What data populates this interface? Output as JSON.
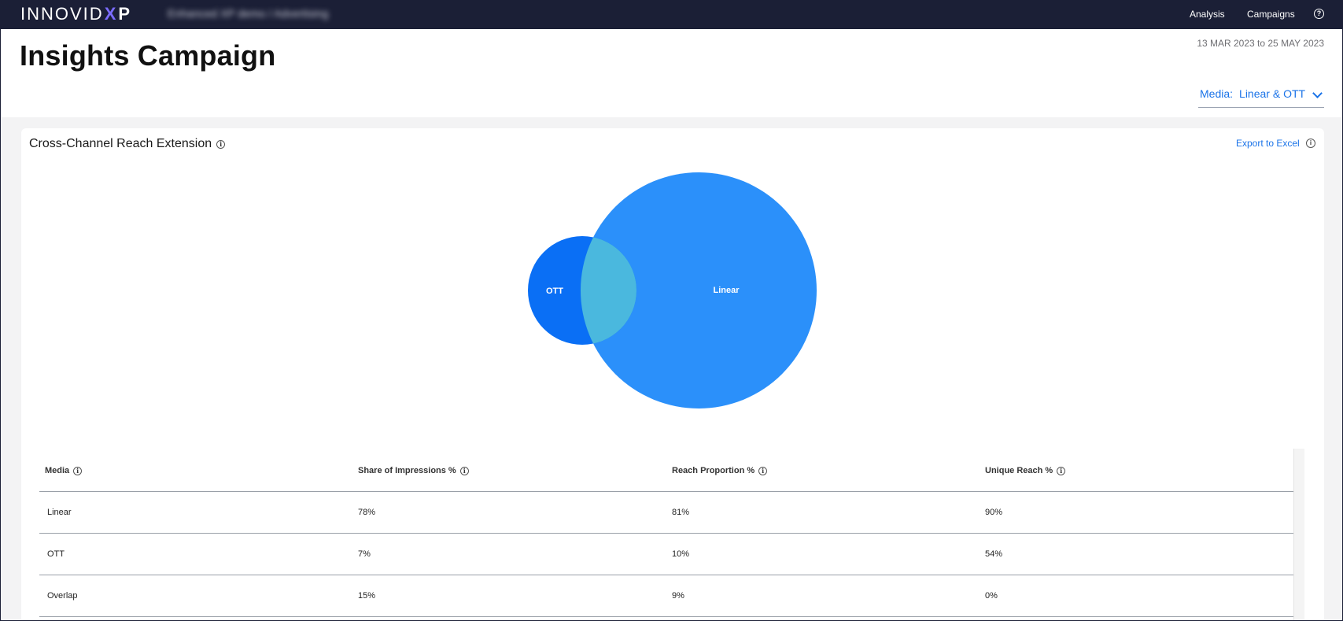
{
  "topbar": {
    "brand": "INNOVID",
    "brand_mark": "X",
    "brand_suffix": "P",
    "account_name": "Enhanced XP demo / Advertising",
    "nav": [
      "Analysis",
      "Campaigns"
    ],
    "help_icon": "question-circle-icon"
  },
  "header": {
    "title": "Insights Campaign",
    "date_range": "13 MAR 2023 to 25 MAY 2023",
    "media_filter_label": "Media:",
    "media_filter_value": "Linear & OTT"
  },
  "card": {
    "title": "Cross-Channel Reach Extension",
    "export_label": "Export to Excel",
    "colors": {
      "ott": "#0a6ff5",
      "linear": "#2b90fa",
      "overlap": "#4ab8de"
    }
  },
  "chart_data": {
    "type": "venn",
    "sets": [
      {
        "name": "OTT",
        "label": "OTT"
      },
      {
        "name": "Linear",
        "label": "Linear"
      }
    ],
    "overlap": {
      "name": "Overlap"
    }
  },
  "table": {
    "columns": [
      "Media",
      "Share of Impressions %",
      "Reach Proportion %",
      "Unique Reach %"
    ],
    "rows": [
      [
        "Linear",
        "78%",
        "81%",
        "90%"
      ],
      [
        "OTT",
        "7%",
        "10%",
        "54%"
      ],
      [
        "Overlap",
        "15%",
        "9%",
        "0%"
      ]
    ]
  }
}
